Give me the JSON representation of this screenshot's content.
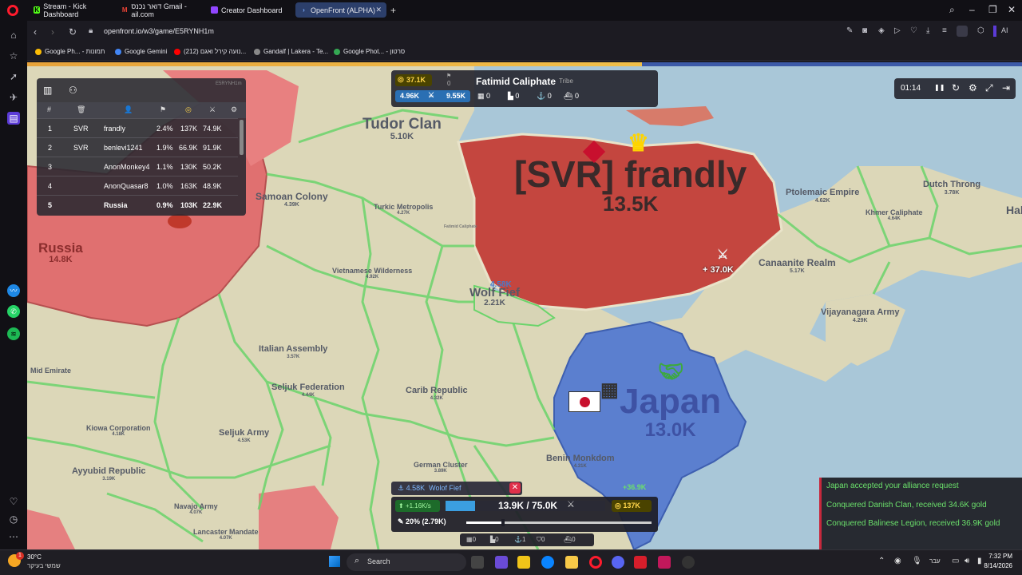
{
  "browser": {
    "tabs": [
      {
        "label": "Stream - Kick Dashboard",
        "active": false,
        "color": "#53fc18"
      },
      {
        "label": "דואר נכנס Gmail - ail.com",
        "active": false,
        "color": "#ea4335"
      },
      {
        "label": "Creator Dashboard",
        "active": false,
        "color": "#9146ff"
      },
      {
        "label": "OpenFront (ALPHA)",
        "active": true,
        "color": "#3b82f6"
      }
    ],
    "new_tab": "+",
    "url": "openfront.io/w3/game/E5RYNH1m",
    "bookmarks": [
      {
        "label": "Google Ph... - תמונות",
        "color": "#fbbc05"
      },
      {
        "label": "Google Gemini",
        "color": "#4285f4"
      },
      {
        "label": "(212) נועה קירל ואגם...",
        "color": "#ff0000"
      },
      {
        "label": "Gandalf | Lakera - Te...",
        "color": "#222222"
      },
      {
        "label": "Google Phot... - סרטון",
        "color": "#34a853"
      }
    ],
    "ai_label": "AI"
  },
  "leaderboard": {
    "game_id": "E5RYNH1m",
    "headers": [
      "#",
      "🗑",
      "👤",
      "⚑",
      "◎",
      "⚔",
      "⚙"
    ],
    "rows": [
      {
        "rank": "1",
        "clan": "SVR",
        "name": "frandly",
        "pct": "2.4%",
        "gold": "137K",
        "troops": "74.9K"
      },
      {
        "rank": "2",
        "clan": "SVR",
        "name": "benlevi1241",
        "pct": "1.9%",
        "gold": "66.9K",
        "troops": "91.9K"
      },
      {
        "rank": "3",
        "clan": "",
        "name": "AnonMonkey4",
        "pct": "1.1%",
        "gold": "130K",
        "troops": "50.2K"
      },
      {
        "rank": "4",
        "clan": "",
        "name": "AnonQuasar8",
        "pct": "1.0%",
        "gold": "163K",
        "troops": "48.9K"
      },
      {
        "rank": "5",
        "clan": "",
        "name": "Russia",
        "pct": "0.9%",
        "gold": "103K",
        "troops": "22.9K"
      }
    ]
  },
  "target_card": {
    "gold": "37.1K",
    "troop_count_small": "0",
    "name": "Fatimid Caliphate",
    "type": "Tribe",
    "troops": "4.96K",
    "max_troops": "9.55K",
    "cities": "0",
    "factories": "0",
    "ports": "0",
    "warships": "0"
  },
  "timer": {
    "time": "01:14",
    "pause_icon": "❚❚",
    "restart_icon": "↻",
    "settings_icon": "⚙",
    "fullscreen_icon": "⤢",
    "exit_icon": "⇥"
  },
  "map_labels": [
    {
      "name": "Tudor Clan",
      "value": "5.10K"
    },
    {
      "name": "Samoan Colony",
      "value": "4.39K"
    },
    {
      "name": "Turkic Metropolis",
      "value": "4.27K"
    },
    {
      "name": "Russia",
      "value": "14.8K"
    },
    {
      "name": "Vietnamese Wilderness",
      "value": "4.92K"
    },
    {
      "name": "Wolf Fief",
      "value": "2.21K"
    },
    {
      "name": "[SVR] frandly",
      "value": "13.5K"
    },
    {
      "name": "Ptolemaic Empire",
      "value": "4.62K"
    },
    {
      "name": "Dutch Throng",
      "value": "3.78K"
    },
    {
      "name": "Khmer Caliphate",
      "value": "4.64K"
    },
    {
      "name": "Canaanite Realm",
      "value": "5.17K"
    },
    {
      "name": "Vijayanagara Army",
      "value": "4.29K"
    },
    {
      "name": "Italian Assembly",
      "value": "3.57K"
    },
    {
      "name": "Seljuk Federation",
      "value": "4.44K"
    },
    {
      "name": "Carib Republic",
      "value": "4.32K"
    },
    {
      "name": "Japan",
      "value": "13.0K"
    },
    {
      "name": "Kiowa Corporation",
      "value": "4.18K"
    },
    {
      "name": "Seljuk Army",
      "value": "4.53K"
    },
    {
      "name": "Ayyubid Republic",
      "value": "3.19K"
    },
    {
      "name": "German Cluster",
      "value": "3.89K"
    },
    {
      "name": "Benin Monkdom",
      "value": "4.31K"
    },
    {
      "name": "Navajo Army",
      "value": "4.07K"
    },
    {
      "name": "Lancaster Mandate",
      "value": "4.07K"
    },
    {
      "name": "Fatimid Caliphate",
      "value": ""
    },
    {
      "name": "Mid Emirate",
      "value": ""
    },
    {
      "name": "Hab",
      "value": ""
    }
  ],
  "map_extra": {
    "attack_troops_label": "4.58K",
    "incoming_attack": "+ 37.0K",
    "boat_troops": "+36.9K"
  },
  "hud": {
    "selected_troops": "4.58K",
    "selected_name": "Wolof Fief",
    "close": "✕",
    "troop_rate": "+1.16K/s",
    "troops": "13.9K / 75.0K",
    "gold": "137K",
    "attack_ratio": "20% (2.79K)",
    "cities": "0",
    "factories": "0",
    "ports": "1",
    "defense": "0",
    "warships": "0",
    "troop_fill": 0.185,
    "ratio_fill": 0.2
  },
  "events": [
    "Japan accepted your alliance request",
    "Conquered Danish Clan, received 34.6K gold",
    "Conquered Balinese Legion, received 36.9K gold"
  ],
  "taskbar": {
    "weather_temp": "30°C",
    "weather_desc": "שמשי בעיקר",
    "search": "Search",
    "lang": "עבר",
    "time": "7:32 PM",
    "date": "8/14/2026",
    "notification_count": "1"
  }
}
